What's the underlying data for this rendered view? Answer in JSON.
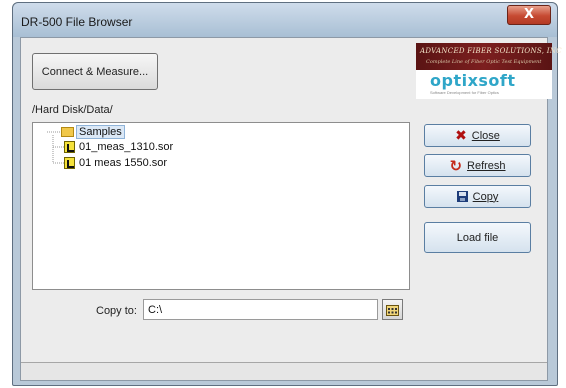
{
  "window": {
    "title": "DR-500 File Browser",
    "close_glyph": "X"
  },
  "connect_button": {
    "label": "Connect & Measure..."
  },
  "logo": {
    "company": "ADVANCED FIBER SOLUTIONS, INC",
    "tagline": "Complete Line of Fiber Optic Test Equipment",
    "product": "optixsoft",
    "product_sub": "Software Development for Fiber Optics"
  },
  "path": "/Hard Disk/Data/",
  "tree": {
    "folder": "Samples",
    "files": [
      "01_meas_1310.sor",
      "01 meas 1550.sor"
    ]
  },
  "buttons": {
    "close": "Close",
    "refresh": "Refresh",
    "copy": "Copy",
    "load": "Load file"
  },
  "copy_to": {
    "label": "Copy to:",
    "value": "C:\\"
  },
  "colors": {
    "title_bar": "#b9c9d8",
    "close_red": "#c64a32",
    "logo_band": "#7c1f1f",
    "logo_product": "#2fa6c8",
    "button_border": "#5a7ea2"
  },
  "icons": {
    "close": "x-icon",
    "refresh": "refresh-icon",
    "copy": "floppy-disk-icon",
    "browse": "folder-browse-icon",
    "folder": "folder-icon",
    "file": "sor-file-icon"
  }
}
